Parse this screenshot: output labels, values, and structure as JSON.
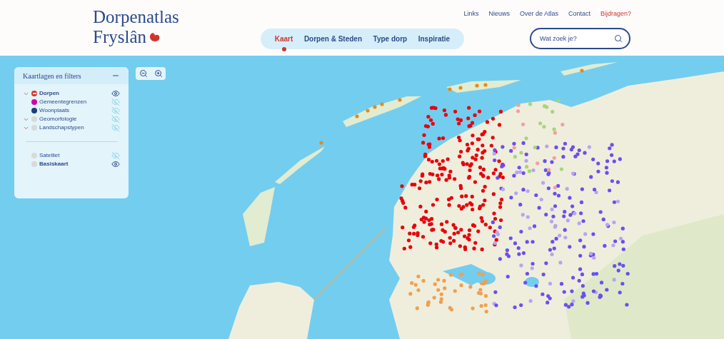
{
  "logo": {
    "lines": [
      "Dorpenatlas",
      "Fryslân"
    ]
  },
  "top_links": [
    {
      "label": "Links",
      "highlighted": false
    },
    {
      "label": "Nieuws",
      "highlighted": false
    },
    {
      "label": "Over de Atlas",
      "highlighted": false
    },
    {
      "label": "Contact",
      "highlighted": false
    },
    {
      "label": "Bijdragen?",
      "highlighted": true
    }
  ],
  "nav": [
    {
      "label": "Kaart",
      "selected": true
    },
    {
      "label": "Dorpen & Steden",
      "selected": false
    },
    {
      "label": "Type dorp",
      "selected": false
    },
    {
      "label": "Inspiratie",
      "selected": false
    }
  ],
  "search": {
    "placeholder": "Wat zoek je?"
  },
  "layer_panel": {
    "title": "Kaartlagen en filters",
    "expanded": true,
    "layers": [
      {
        "label": "Dorpen",
        "collapsible": true,
        "visible": true,
        "kind": "icon",
        "color": "#d8322b"
      },
      {
        "label": "Gemeentegrenzen",
        "collapsible": false,
        "visible": false,
        "kind": "dot",
        "color": "#d000b0"
      },
      {
        "label": "Woonplaats",
        "collapsible": false,
        "visible": false,
        "kind": "dot",
        "color": "#1f3d7a"
      },
      {
        "label": "Geomorfologie",
        "collapsible": true,
        "visible": false,
        "kind": "dot",
        "color": "#d9d9d9"
      },
      {
        "label": "Landschapstypen",
        "collapsible": true,
        "visible": false,
        "kind": "dot",
        "color": "#d9d9d9"
      }
    ],
    "base_layers": [
      {
        "label": "Satelliet",
        "visible": false,
        "color": "#d9d9d9"
      },
      {
        "label": "Basiskaart",
        "visible": true,
        "color": "#d9d9d9"
      }
    ]
  }
}
